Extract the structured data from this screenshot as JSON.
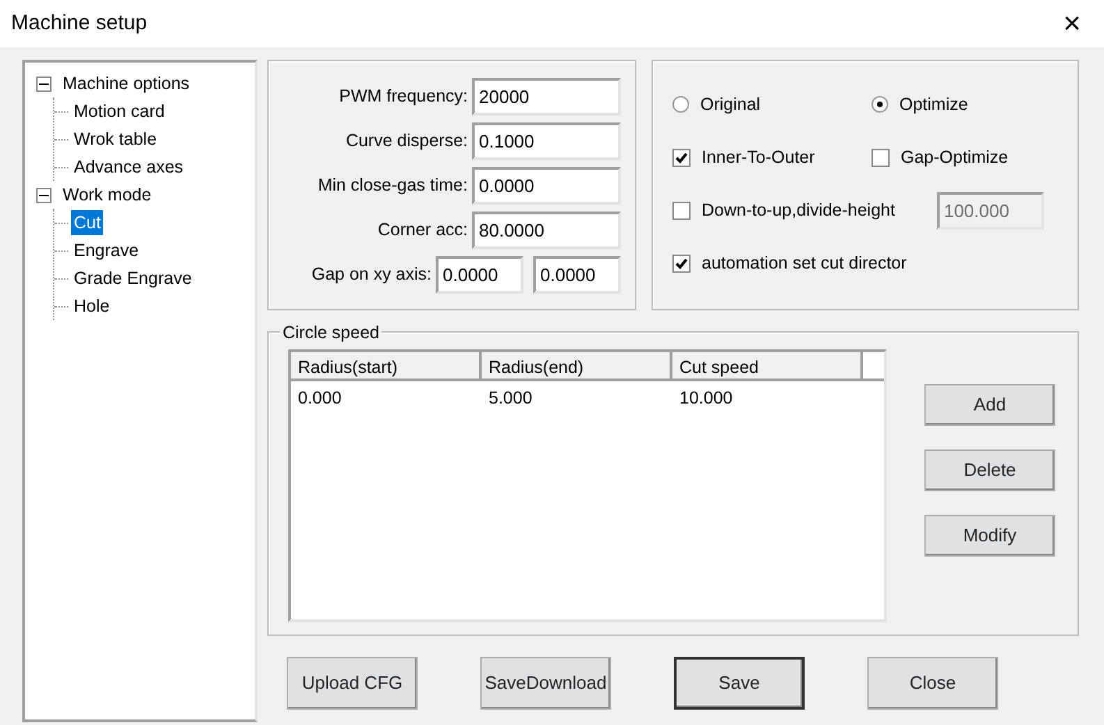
{
  "window": {
    "title": "Machine setup",
    "close": "×"
  },
  "tree": [
    {
      "label": "Machine options",
      "expanded": true,
      "selected": false,
      "children": [
        {
          "label": "Motion card",
          "selected": false
        },
        {
          "label": "Wrok table",
          "selected": false
        },
        {
          "label": "Advance axes",
          "selected": false
        }
      ]
    },
    {
      "label": "Work mode",
      "expanded": true,
      "selected": false,
      "children": [
        {
          "label": "Cut",
          "selected": true
        },
        {
          "label": "Engrave",
          "selected": false
        },
        {
          "label": "Grade Engrave",
          "selected": false
        },
        {
          "label": "Hole",
          "selected": false
        }
      ]
    }
  ],
  "params": [
    {
      "label": "PWM frequency:",
      "values": [
        "20000"
      ]
    },
    {
      "label": "Curve disperse:",
      "values": [
        "0.1000"
      ]
    },
    {
      "label": "Min close-gas time:",
      "values": [
        "0.0000"
      ]
    },
    {
      "label": "Corner acc:",
      "values": [
        "80.0000"
      ]
    },
    {
      "label": "Gap on xy axis:",
      "values": [
        "0.0000",
        "0.0000"
      ]
    }
  ],
  "options": [
    {
      "kind": "radio",
      "items": [
        {
          "label": "Original",
          "selected": false
        },
        {
          "label": "Optimize",
          "selected": true
        }
      ]
    },
    {
      "kind": "check",
      "items": [
        {
          "label": "Inner-To-Outer",
          "checked": true
        },
        {
          "label": "Gap-Optimize",
          "checked": false
        }
      ]
    },
    {
      "kind": "check",
      "items": [
        {
          "label": "Down-to-up,divide-height",
          "checked": false
        }
      ],
      "field": {
        "value": "100.000",
        "disabled": true
      }
    },
    {
      "kind": "check",
      "items": [
        {
          "label": "automation set cut director",
          "checked": true
        }
      ]
    }
  ],
  "circle_speed": {
    "title": "Circle speed",
    "columns": [
      "Radius(start)",
      "Radius(end)",
      "Cut speed"
    ],
    "rows": [
      [
        "0.000",
        "5.000",
        "10.000"
      ]
    ],
    "buttons": [
      "Add",
      "Delete",
      "Modify"
    ]
  },
  "buttons": [
    {
      "label": "Upload CFG",
      "default": false
    },
    {
      "label": "SaveDownload",
      "default": false
    },
    {
      "label": "Save",
      "default": true
    },
    {
      "label": "Close",
      "default": false
    }
  ]
}
